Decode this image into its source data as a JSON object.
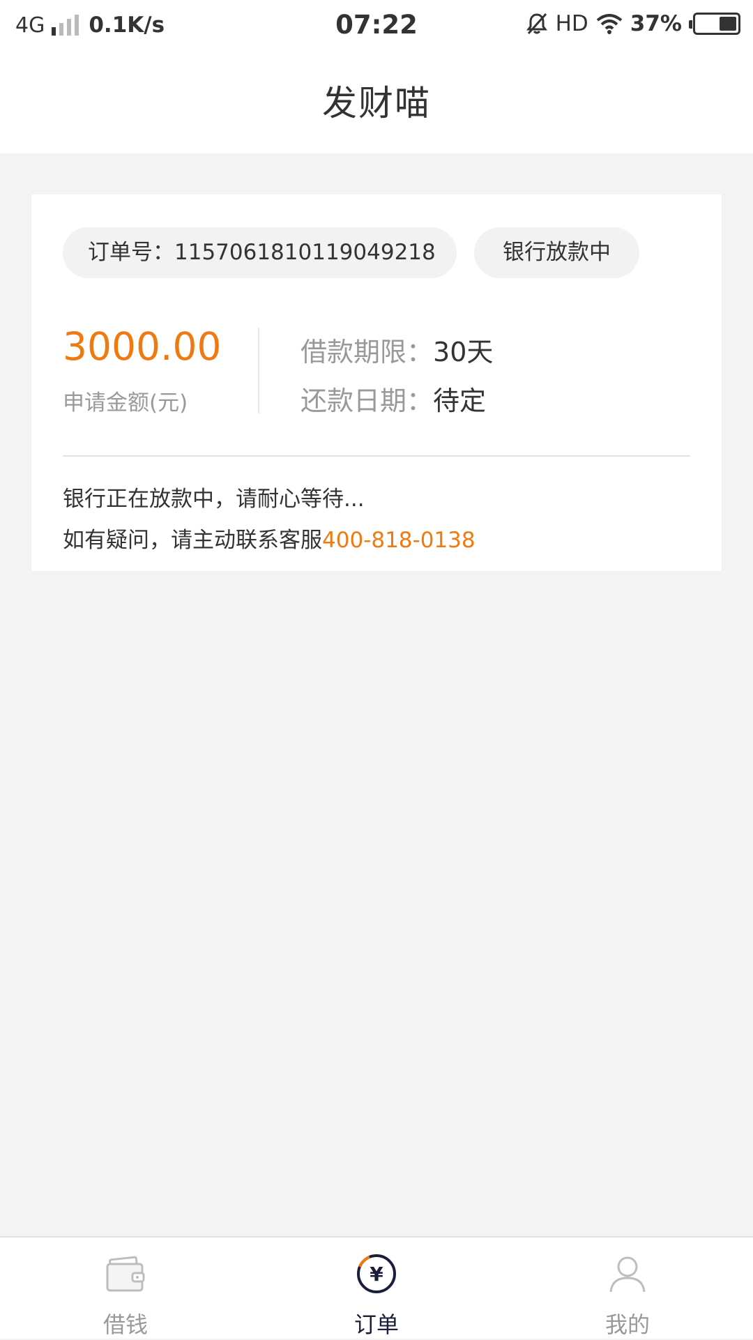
{
  "status_bar": {
    "network": "4G",
    "speed": "0.1K/s",
    "time": "07:22",
    "hd": "HD",
    "battery": "37%"
  },
  "header": {
    "title": "发财喵"
  },
  "order": {
    "order_no_label": "订单号：",
    "order_no": "1157061810119049218",
    "status": "银行放款中",
    "amount": "3000.00",
    "amount_label": "申请金额(元)",
    "term_label": "借款期限：",
    "term_value": "30天",
    "repay_label": "还款日期：",
    "repay_value": "待定",
    "message_line1": "银行正在放款中，请耐心等待...",
    "message_line2_prefix": "如有疑问，请主动联系客服",
    "phone": "400-818-0138"
  },
  "tabs": [
    {
      "label": "借钱",
      "icon": "wallet-icon",
      "active": false
    },
    {
      "label": "订单",
      "icon": "yen-icon",
      "active": true
    },
    {
      "label": "我的",
      "icon": "user-icon",
      "active": false
    }
  ],
  "colors": {
    "accent": "#f07a12",
    "active_tab": "#1a1e3a",
    "background": "#f3f3f3"
  }
}
